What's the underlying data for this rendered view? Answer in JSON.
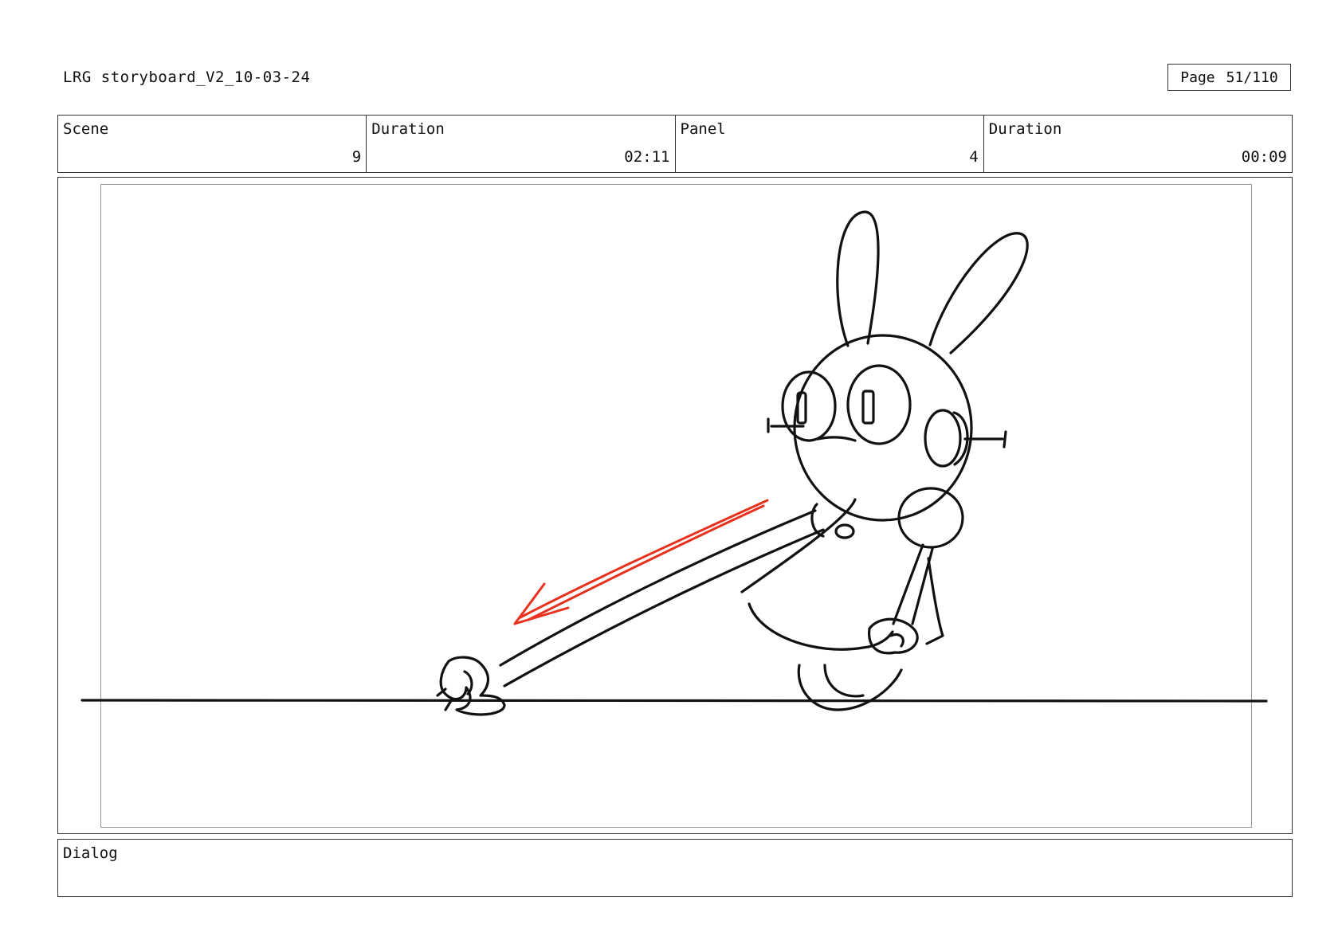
{
  "header": {
    "document_title": "LRG storyboard_V2_10-03-24",
    "page_label": "Page",
    "page_number": "51/110"
  },
  "info": {
    "scene_label": "Scene",
    "scene_value": "9",
    "scene_duration_label": "Duration",
    "scene_duration_value": "02:11",
    "panel_label": "Panel",
    "panel_value": "4",
    "panel_duration_label": "Duration",
    "panel_duration_value": "00:09"
  },
  "panel": {
    "drawing": "rabbit-character-pulling-rope-sketch",
    "line_color": "#111111",
    "arrow_color": "#e8321e"
  },
  "dialog": {
    "label": "Dialog"
  }
}
